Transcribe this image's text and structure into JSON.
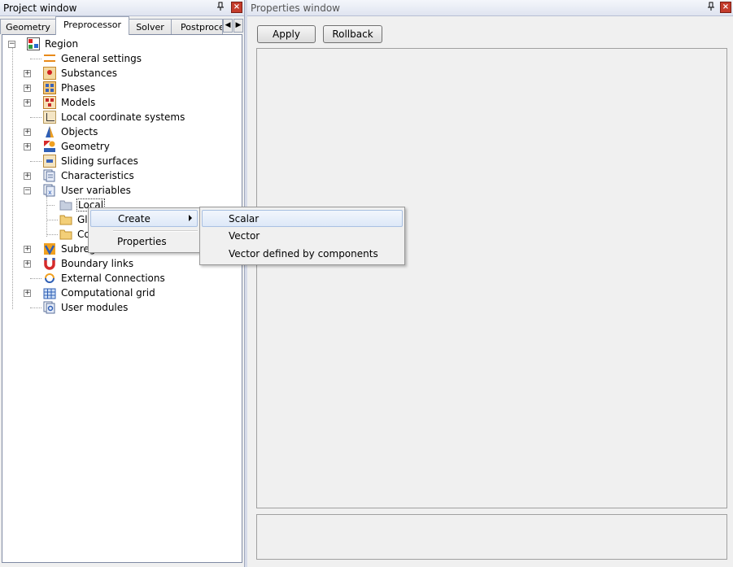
{
  "project_window": {
    "title": "Project window",
    "tabs": [
      {
        "label": "Geometry"
      },
      {
        "label": "Preprocessor"
      },
      {
        "label": "Solver"
      },
      {
        "label": "Postproce"
      }
    ],
    "tree": {
      "root": "Region",
      "items": [
        {
          "label": "General settings"
        },
        {
          "label": "Substances"
        },
        {
          "label": "Phases"
        },
        {
          "label": "Models"
        },
        {
          "label": "Local coordinate systems"
        },
        {
          "label": "Objects"
        },
        {
          "label": "Geometry"
        },
        {
          "label": "Sliding surfaces"
        },
        {
          "label": "Characteristics"
        },
        {
          "label": "User variables"
        },
        {
          "label": "Local"
        },
        {
          "label": "Gl"
        },
        {
          "label": "Co"
        },
        {
          "label": "Subreg"
        },
        {
          "label": "Boundary links"
        },
        {
          "label": "External Connections"
        },
        {
          "label": "Computational grid"
        },
        {
          "label": "User modules"
        }
      ]
    }
  },
  "properties_window": {
    "title": "Properties window",
    "apply_label": "Apply",
    "rollback_label": "Rollback"
  },
  "context_menu": {
    "items": [
      {
        "label": "Create"
      },
      {
        "label": "Properties"
      }
    ]
  },
  "submenu": {
    "items": [
      {
        "label": "Scalar"
      },
      {
        "label": "Vector"
      },
      {
        "label": "Vector defined by components"
      }
    ]
  },
  "colors": {
    "title_bg": "#dfe4f0",
    "close_button": "#c43c2c",
    "highlight": "#dde8f8"
  },
  "icons": {
    "pin": "pin-icon",
    "close": "close-icon",
    "submenu": "chevron-right-icon"
  }
}
